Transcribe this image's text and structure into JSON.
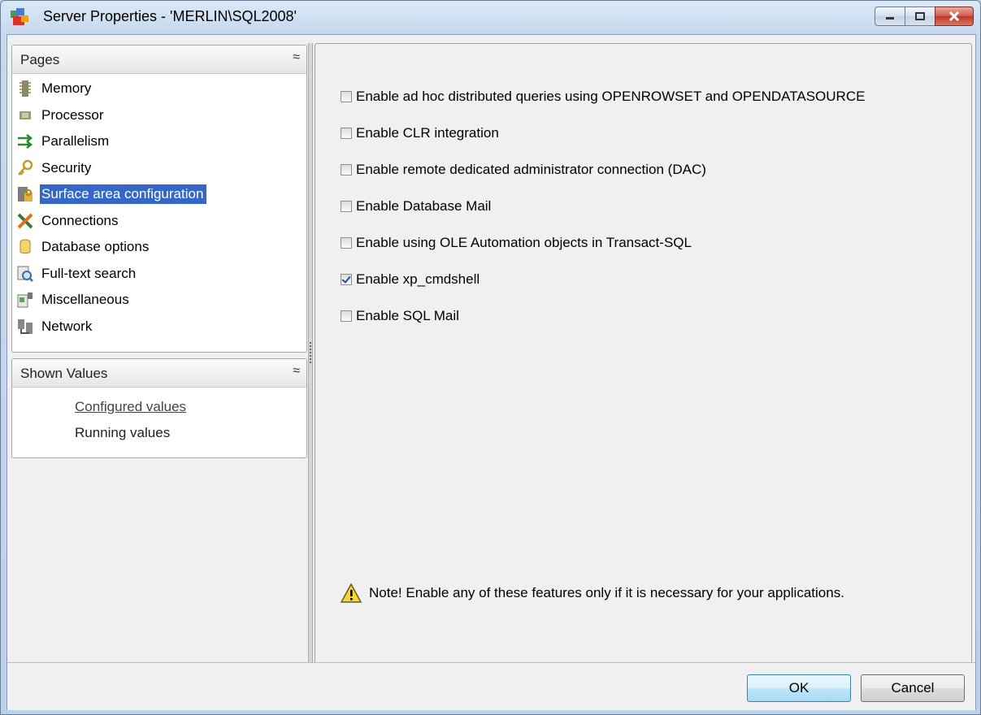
{
  "window": {
    "title": "Server Properties - 'MERLIN\\SQL2008'",
    "controls": {
      "minimize": "minimize",
      "maximize": "maximize",
      "close": "close"
    }
  },
  "pages_panel": {
    "header": "Pages",
    "items": [
      {
        "label": "Memory",
        "icon": "memory-icon"
      },
      {
        "label": "Processor",
        "icon": "processor-icon"
      },
      {
        "label": "Parallelism",
        "icon": "parallelism-icon"
      },
      {
        "label": "Security",
        "icon": "key-icon"
      },
      {
        "label": "Surface area configuration",
        "icon": "surface-area-icon",
        "selected": true
      },
      {
        "label": "Connections",
        "icon": "connections-icon"
      },
      {
        "label": "Database options",
        "icon": "database-icon"
      },
      {
        "label": "Full-text search",
        "icon": "full-text-search-icon"
      },
      {
        "label": "Miscellaneous",
        "icon": "miscellaneous-icon"
      },
      {
        "label": "Network",
        "icon": "network-icon"
      }
    ]
  },
  "shown_values_panel": {
    "header": "Shown Values",
    "items": [
      {
        "label": "Configured values",
        "active": true
      },
      {
        "label": "Running values",
        "active": false
      }
    ]
  },
  "options": [
    {
      "label": "Enable ad hoc distributed queries using OPENROWSET and OPENDATASOURCE",
      "checked": false
    },
    {
      "label": "Enable CLR integration",
      "checked": false
    },
    {
      "label": "Enable remote dedicated administrator connection (DAC)",
      "checked": false
    },
    {
      "label": "Enable Database Mail",
      "checked": false
    },
    {
      "label": "Enable using OLE Automation objects in Transact-SQL",
      "checked": false
    },
    {
      "label": "Enable xp_cmdshell",
      "checked": true
    },
    {
      "label": "Enable SQL Mail",
      "checked": false
    }
  ],
  "note": "Note! Enable any of these features only if it is necessary for your applications.",
  "buttons": {
    "ok": "OK",
    "cancel": "Cancel"
  }
}
